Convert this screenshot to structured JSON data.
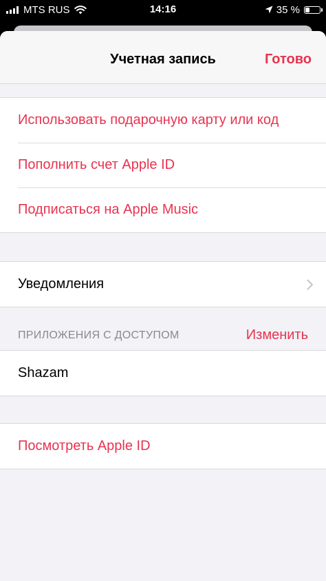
{
  "status_bar": {
    "carrier": "MTS RUS",
    "time": "14:16",
    "battery_percent_label": "35 %",
    "battery_level": 0.35,
    "icons": [
      "signal-icon",
      "wifi-icon",
      "location-arrow-icon",
      "battery-icon"
    ]
  },
  "nav": {
    "title": "Учетная запись",
    "done_label": "Готово"
  },
  "actions": {
    "items": [
      {
        "label": "Использовать подарочную карту или код"
      },
      {
        "label": "Пополнить счет Apple ID"
      },
      {
        "label": "Подписаться на Apple Music"
      }
    ]
  },
  "notifications": {
    "label": "Уведомления",
    "icon": "chevron-right-icon"
  },
  "apps_section": {
    "header": "ПРИЛОЖЕНИЯ С ДОСТУПОМ",
    "edit_label": "Изменить",
    "apps": [
      {
        "name": "Shazam"
      }
    ]
  },
  "view_apple_id": {
    "label": "Посмотреть Apple ID"
  },
  "colors": {
    "accent": "#e8334f",
    "background": "#f2f2f7",
    "header_text": "#8a8a8e"
  }
}
